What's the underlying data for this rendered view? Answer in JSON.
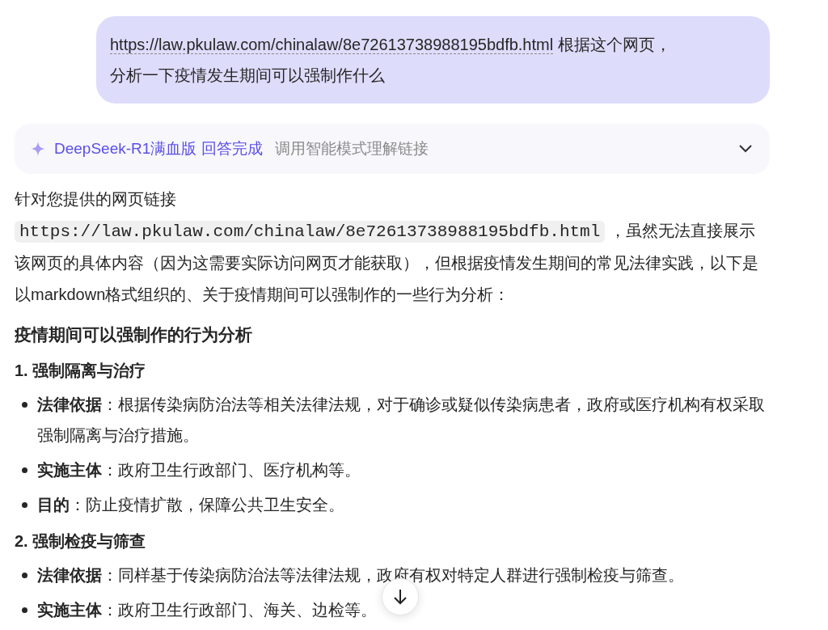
{
  "user_message": {
    "link": "https://law.pkulaw.com/chinalaw/8e72613738988195bdfb.html",
    "texts": [
      "根据这个网页，",
      "分析一下疫情发生期间可以强制作什么"
    ]
  },
  "status_bar": {
    "model": "DeepSeek-R1满血版",
    "state": "回答完成",
    "note": "调用智能模式理解链接",
    "expanded": false
  },
  "answer": {
    "intro_before": "针对您提供的网页链接",
    "code": "https://law.pkulaw.com/chinalaw/8e72613738988195bdfb.html",
    "intro_after": "，虽然无法直接展示该网页的具体内容（因为这需要实际访问网页才能获取），但根据疫情发生期间的常见法律实践，以下是以markdown格式组织的、关于疫情期间可以强制作的一些行为分析：",
    "heading": "疫情期间可以强制作的行为分析",
    "sections": [
      {
        "title": "1. 强制隔离与治疗",
        "items": [
          {
            "label": "法律依据",
            "text": "：根据传染病防治法等相关法律法规，对于确诊或疑似传染病患者，政府或医疗机构有权采取强制隔离与治疗措施。"
          },
          {
            "label": "实施主体",
            "text": "：政府卫生行政部门、医疗机构等。"
          },
          {
            "label": "目的",
            "text": "：防止疫情扩散，保障公共卫生安全。"
          }
        ]
      },
      {
        "title": "2. 强制检疫与筛查",
        "items": [
          {
            "label": "法律依据",
            "text": "：同样基于传染病防治法等法律法规，政府有权对特定人群进行强制检疫与筛查。"
          },
          {
            "label": "实施主体",
            "text": "：政府卫生行政部门、海关、边检等。"
          }
        ]
      }
    ]
  }
}
